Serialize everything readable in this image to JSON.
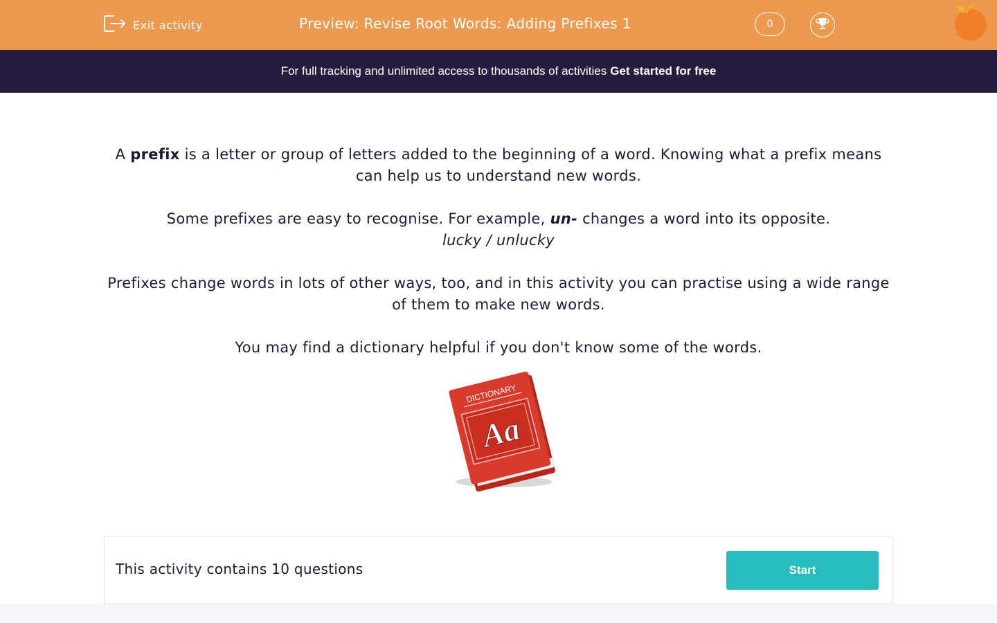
{
  "header": {
    "exit_label": "Exit activity",
    "title": "Preview: Revise Root Words: Adding Prefixes 1",
    "score": "0",
    "accent_color": "#ec9a50"
  },
  "banner": {
    "text": "For full tracking and unlimited access to thousands of activities",
    "cta": "Get started for free",
    "background": "#251d3e"
  },
  "intro": {
    "p1_a": "A ",
    "p1_bold": "prefix",
    "p1_b": " is a letter or group of letters added to the beginning of a word. Knowing what a prefix means can help us to understand new words.",
    "p2_a": "Some prefixes are easy to recognise. For example, ",
    "p2_bold": "un-",
    "p2_b": " changes a word into its opposite.",
    "p2_example": "lucky / unlucky",
    "p3": "Prefixes change words in lots of other ways, too, and in this activity you can practise using a wide range of them to make new words.",
    "p4": "You may find a dictionary helpful if you don't know some of the words."
  },
  "image": {
    "book_label": "DICTIONARY",
    "book_letters": "Aa"
  },
  "footer": {
    "question_count_text": "This activity contains 10 questions",
    "start_label": "Start",
    "button_color": "#27bcbd"
  }
}
